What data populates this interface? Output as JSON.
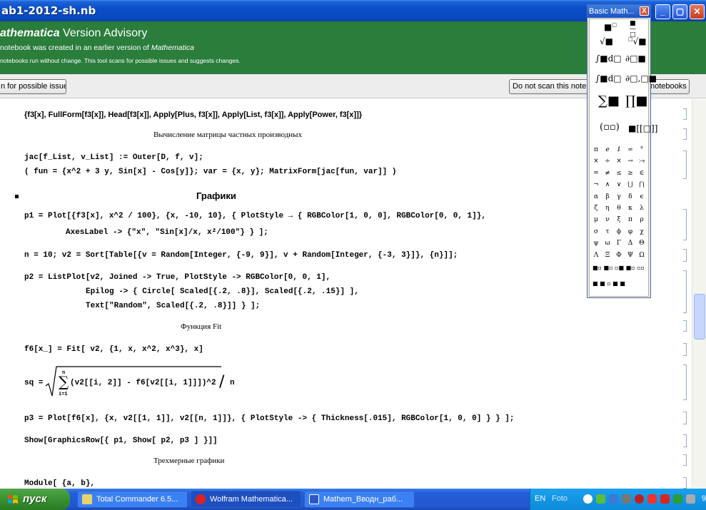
{
  "window": {
    "title": "ab1-2012-sh.nb"
  },
  "advisory": {
    "title_italic": "athematica",
    "title_rest": " Version Advisory",
    "line1_pre": "notebook was created in an earlier version of ",
    "line1_italic": "Mathematica",
    "line2": "notebooks run without change. This tool scans for possible issues and suggests changes."
  },
  "buttons": {
    "scan": "n for possible issues",
    "donot": "Do not scan this notebo",
    "notebooks": "notebooks"
  },
  "palette": {
    "title": "Basic Math...",
    "close": "X",
    "greek_rows": [
      [
        "π",
        "ℯ",
        "ⅈ",
        "∞",
        "°"
      ],
      [
        "×",
        "÷",
        "×",
        "→",
        "⧴"
      ],
      [
        "=",
        "≠",
        "≤",
        "≥",
        "∈"
      ],
      [
        "¬",
        "∧",
        "∨",
        "⋃",
        "⋂"
      ],
      [
        "α",
        "β",
        "γ",
        "δ",
        "ϵ"
      ],
      [
        "ζ",
        "η",
        "θ",
        "κ",
        "λ"
      ],
      [
        "μ",
        "ν",
        "ξ",
        "π",
        "ρ"
      ],
      [
        "σ",
        "τ",
        "ϕ",
        "φ",
        "χ"
      ],
      [
        "ψ",
        "ω",
        "Γ",
        "Δ",
        "Θ"
      ],
      [
        "Λ",
        "Ξ",
        "Φ",
        "Ψ",
        "Ω"
      ]
    ]
  },
  "notebook": {
    "line_f3": "{f3[x], FullForm[f3[x]], Head[f3[x]], Apply[Plus, f3[x]], Apply[List, f3[x]], Apply[Power, f3[x]]}",
    "text_jac": "Вычисление матрицы частных производных",
    "line_jac1": "jac[f_List, v_List] := Outer[D, f, v];",
    "line_jac2": "( fun = {x^2 + 3 y, Sin[x] - Cos[y]}; var = {x, y}; MatrixForm[jac[fun, var]] )",
    "section_graphs": "Графики",
    "line_p1a": "p1 = Plot[{f3[x], x^2 / 100}, {x, -10, 10}, { PlotStyle → { RGBColor[1, 0, 0], RGBColor[0, 0, 1]},",
    "line_p1b": "AxesLabel -> {\"x\", \"Sin[x]/x, x²/100\"} } ];",
    "line_n": "n = 10; v2 = Sort[Table[{v = Random[Integer, {-9, 9}], v + Random[Integer, {-3, 3}]}, {n}]];",
    "line_p2a": "p2 = ListPlot[v2, Joined -> True, PlotStyle -> RGBColor[0, 0, 1],",
    "line_p2b": "Epilog -> { Circle[ Scaled[{.2, .8}], Scaled[{.2, .15}] ],",
    "line_p2c": "Text[\"Random\", Scaled[{.2, .8}]] } ];",
    "text_fit": "Функция Fit",
    "line_f6": "f6[x_] = Fit[ v2, {1, x, x^2, x^3}, x]",
    "sq_lhs": "sq =",
    "sq_sum_top": "n",
    "sq_sum_bottom": "i=1",
    "sq_body": "(v2[[i, 2]] - f6[v2[[i, 1]]])^2",
    "sq_div": "/",
    "sq_n": "n",
    "line_p3": "p3 = Plot[f6[x], {x, v2[[1, 1]], v2[[n, 1]]}, { PlotStyle -> { Thickness[.015], RGBColor[1, 0, 0] } } ];",
    "line_show": "Show[GraphicsRow[{ p1, Show[ p2, p3 ] }]]",
    "text_3d": "Трехмерные графики",
    "line_module": "Module[ {a, b},"
  },
  "taskbar": {
    "start": "пуск",
    "tasks": [
      "Total Commander 6.5...",
      "Wolfram Mathematica...",
      "Mathem_Вводн_раб..."
    ],
    "lang": "EN",
    "foto": "Foto",
    "clock": "9"
  },
  "colors": {
    "advisory_green": "#2a7d3b",
    "titlebar_blue": "#0a4ec8",
    "code_var_blue": "#2a3bd6"
  }
}
